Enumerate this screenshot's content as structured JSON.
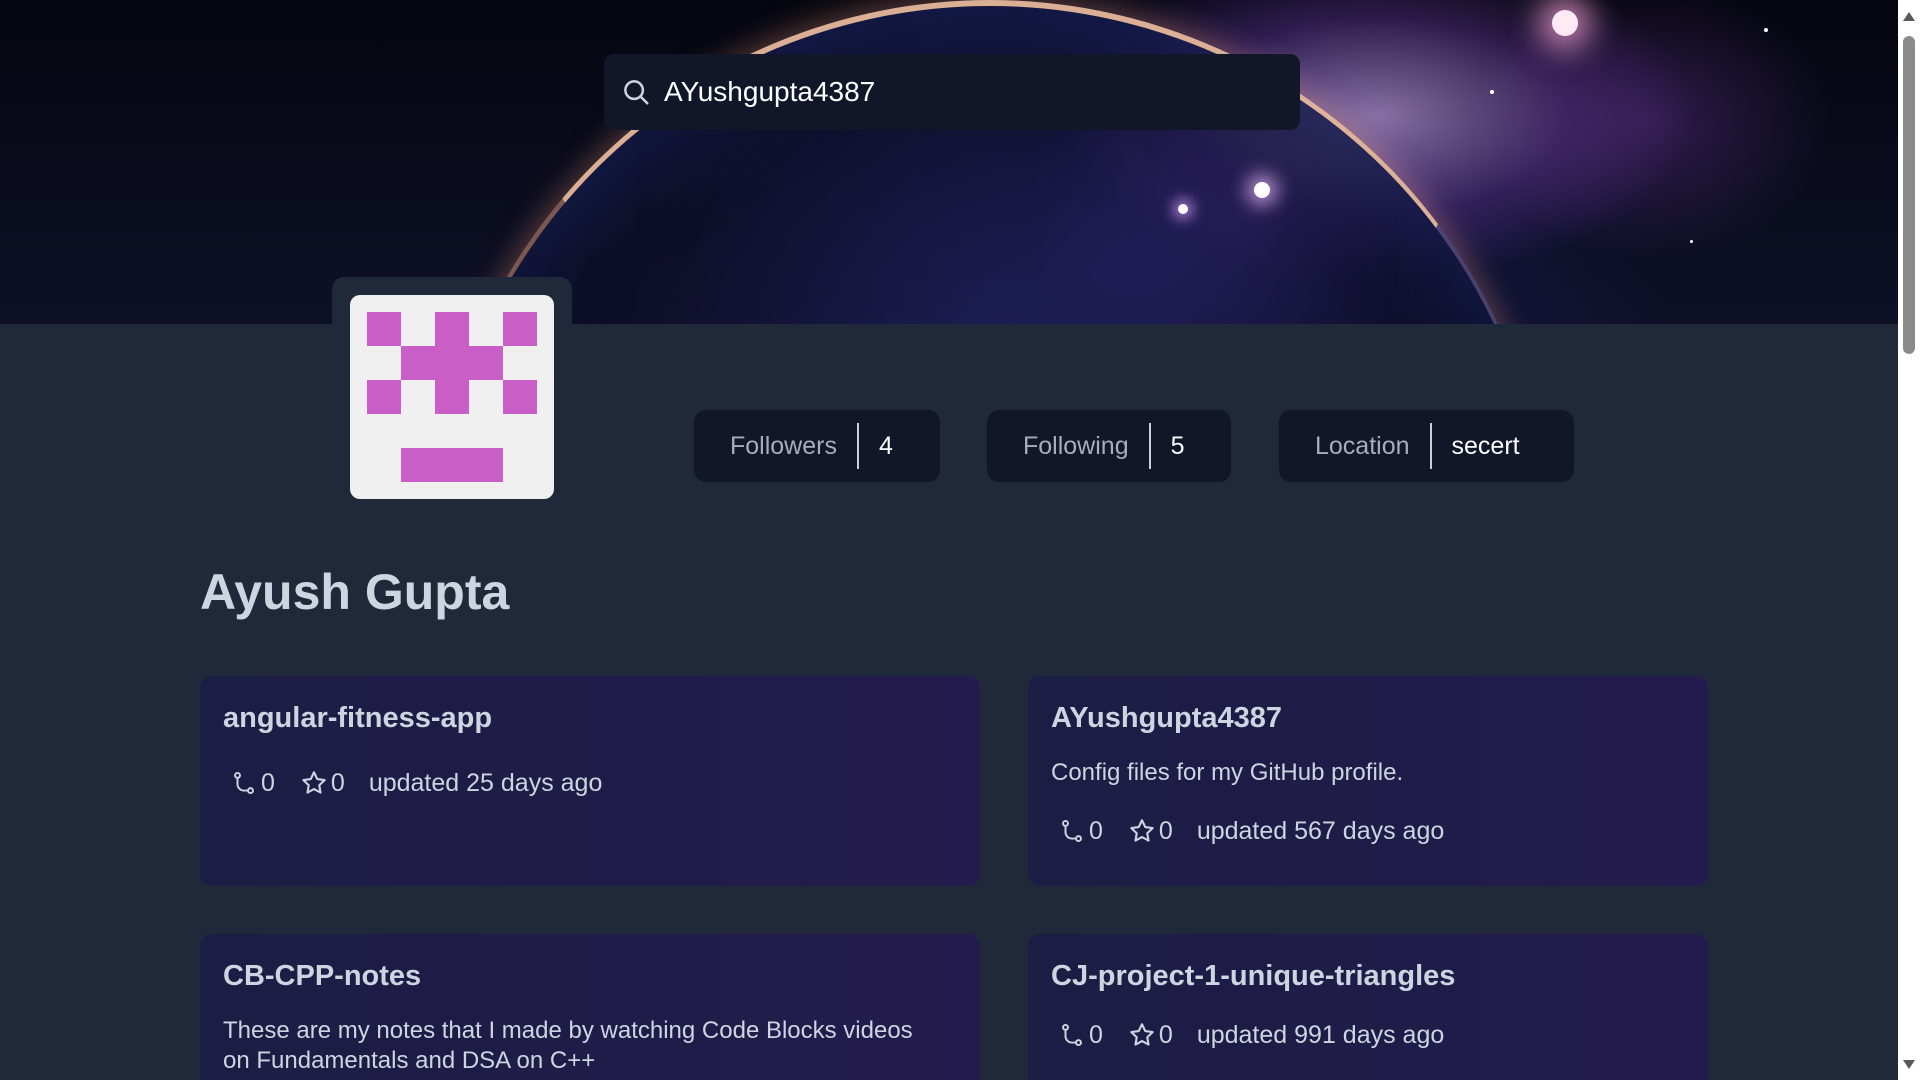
{
  "search": {
    "value": "AYushgupta4387",
    "icon": "search-icon"
  },
  "profile": {
    "name": "Ayush Gupta",
    "avatar_color": "#c95ec7",
    "stats": [
      {
        "label": "Followers",
        "value": "4"
      },
      {
        "label": "Following",
        "value": "5"
      },
      {
        "label": "Location",
        "value": "secert"
      }
    ]
  },
  "repos": [
    {
      "name": "angular-fitness-app",
      "description": "",
      "forks": "0",
      "stars": "0",
      "updated": "updated 25 days ago"
    },
    {
      "name": "AYushgupta4387",
      "description": "Config files for my GitHub profile.",
      "forks": "0",
      "stars": "0",
      "updated": "updated 567 days ago"
    },
    {
      "name": "CB-CPP-notes",
      "description": "These are my notes that I made by watching Code Blocks videos on Fundamentals and DSA on C++",
      "forks": "",
      "stars": "",
      "updated": ""
    },
    {
      "name": "CJ-project-1-unique-triangles",
      "description": "",
      "forks": "0",
      "stars": "0",
      "updated": "updated 991 days ago"
    }
  ],
  "icons": {
    "fork": "fork-icon",
    "star": "star-icon"
  },
  "colors": {
    "background": "#20293a",
    "card": "#111729",
    "repo_card": "#1c1d44",
    "text": "#cdd5e0"
  }
}
